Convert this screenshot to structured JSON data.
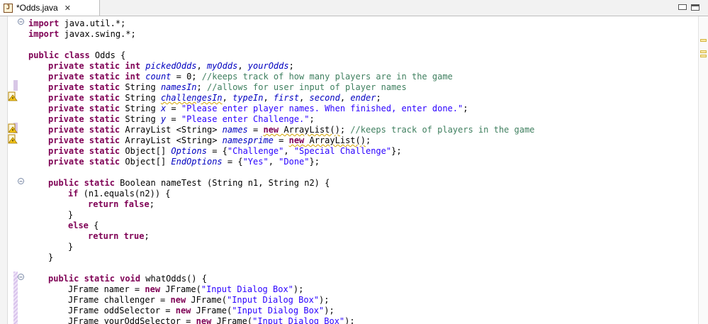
{
  "tab": {
    "title": "*Odds.java",
    "close_symbol": "✕",
    "file_icon": "J"
  },
  "gutter": {
    "fold_collapse_symbol": "−",
    "warning_icon_name": "warning-icon",
    "marker_color": "#d8c7e6"
  },
  "colors": {
    "keyword": "#7f0055",
    "field": "#0000c0",
    "string": "#2a00ff",
    "comment": "#3f7f5f"
  },
  "code": {
    "l1_kw": "import",
    "l1_rest": " java.util.*;",
    "l2_kw": "import",
    "l2_rest": " javax.swing.*;",
    "l4_kw": "public class",
    "l4_rest": " Odds {",
    "l5_kw": "private static int",
    "l5_sp": " ",
    "l5_f1": "pickedOdds",
    "l5_c1": ", ",
    "l5_f2": "myOdds",
    "l5_c2": ", ",
    "l5_f3": "yourOdds",
    "l5_end": ";",
    "l6_kw": "private static int",
    "l6_sp": " ",
    "l6_f1": "count",
    "l6_mid": " = 0; ",
    "l6_cmt": "//keeps track of how many players are in the game",
    "l7_kw": "private static",
    "l7_type": " String ",
    "l7_f1": "namesIn",
    "l7_mid": "; ",
    "l7_cmt": "//allows for user input of player names",
    "l8_kw": "private static",
    "l8_type": " String ",
    "l8_f1": "challengesIn",
    "l8_c1": ", ",
    "l8_f2": "typeIn",
    "l8_c2": ", ",
    "l8_f3": "first",
    "l8_c3": ", ",
    "l8_f4": "second",
    "l8_c4": ", ",
    "l8_f5": "ender",
    "l8_end": ";",
    "l9_kw": "private static",
    "l9_type": " String ",
    "l9_f1": "x",
    "l9_mid": " = ",
    "l9_str": "\"Please enter player names. When finished, enter done.\"",
    "l9_end": ";",
    "l10_kw": "private static",
    "l10_type": " String ",
    "l10_f1": "y",
    "l10_mid": " = ",
    "l10_str": "\"Please enter Challenge.\"",
    "l10_end": ";",
    "l11_kw": "private static",
    "l11_type": " ArrayList <String> ",
    "l11_f1": "names",
    "l11_mid": " = ",
    "l11_new": "new",
    "l11_rest": " ArrayList()",
    "l11_end": "; ",
    "l11_cmt": "//keeps track of players in the game",
    "l12_kw": "private static",
    "l12_type": " ArrayList <String> ",
    "l12_f1": "namesprime",
    "l12_mid": " = ",
    "l12_new": "new",
    "l12_rest": " ArrayList()",
    "l12_end": ";",
    "l13_kw": "private static",
    "l13_type": " Object[] ",
    "l13_f1": "Options",
    "l13_mid": " = {",
    "l13_s1": "\"Challenge\"",
    "l13_c1": ", ",
    "l13_s2": "\"Special Challenge\"",
    "l13_end": "};",
    "l14_kw": "private static",
    "l14_type": " Object[] ",
    "l14_f1": "EndOptions",
    "l14_mid": " = {",
    "l14_s1": "\"Yes\"",
    "l14_c1": ", ",
    "l14_s2": "\"Done\"",
    "l14_end": "};",
    "l16_kw": "public static",
    "l16_rest": " Boolean nameTest (String n1, String n2) {",
    "l17_kw": "if",
    "l17_rest": " (n1.equals(n2)) {",
    "l18_kw": "return false",
    "l18_rest": ";",
    "l19_text": "}",
    "l20_kw": "else",
    "l20_rest": " {",
    "l21_kw": "return true",
    "l21_rest": ";",
    "l22_text": "}",
    "l23_text": "}",
    "l25_kw": "public static void",
    "l25_rest": " whatOdds() {",
    "l26_a": "JFrame namer = ",
    "l26_new": "new",
    "l26_b": " JFrame(",
    "l26_str": "\"Input Dialog Box\"",
    "l26_end": ");",
    "l27_a": "JFrame challenger = ",
    "l27_new": "new",
    "l27_b": " JFrame(",
    "l27_str": "\"Input Dialog Box\"",
    "l27_end": ");",
    "l28_a": "JFrame oddSelector = ",
    "l28_new": "new",
    "l28_b": " JFrame(",
    "l28_str": "\"Input Dialog Box\"",
    "l28_end": ");",
    "l29_a": "JFrame yourOddSelector = ",
    "l29_new": "new",
    "l29_b": " JFrame(",
    "l29_str": "\"Input Dialog Box\"",
    "l29_end": ");"
  }
}
